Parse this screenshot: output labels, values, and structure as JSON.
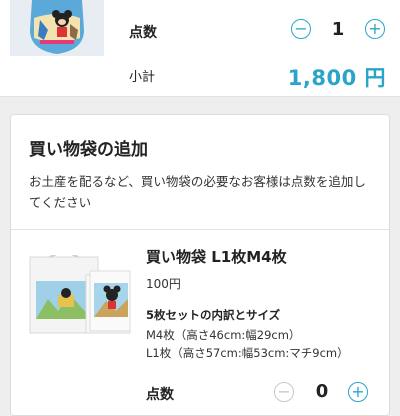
{
  "cart_item": {
    "quantity_label": "点数",
    "quantity_value": "1",
    "minus_icon": "minus-icon",
    "plus_icon": "plus-icon",
    "subtotal_label": "小計",
    "subtotal_value": "1,800 円"
  },
  "bag_section": {
    "title": "買い物袋の追加",
    "description": "お土産を配るなど、買い物袋の必要なお客様は点数を追加してください",
    "item": {
      "name": "買い物袋 L1枚M4枚",
      "price": "100円",
      "spec_title": "5枚セットの内訳とサイズ",
      "spec_lines": [
        "M4枚（高さ46cm:幅29cm）",
        "L1枚（高さ57cm:幅53cm:マチ9cm）"
      ],
      "quantity_label": "点数",
      "quantity_value": "0"
    }
  },
  "colors": {
    "accent": "#2aa5c9",
    "disabled": "#c8c8c8",
    "background": "#eeeeee"
  }
}
